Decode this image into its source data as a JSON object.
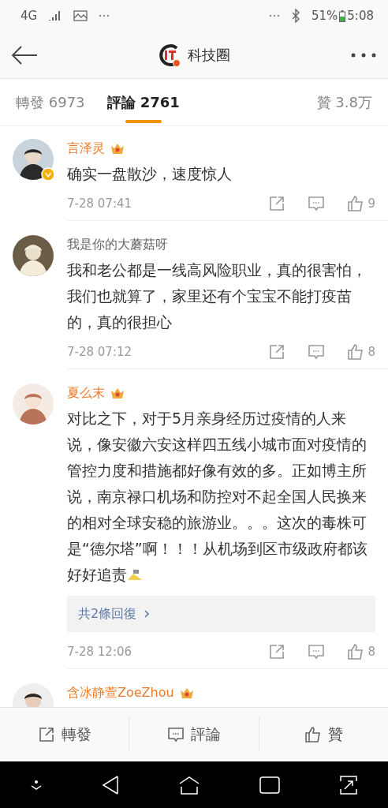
{
  "status_bar": {
    "network": "4G",
    "battery": "51%",
    "time": "5:08"
  },
  "header": {
    "title": "科技圈",
    "verified": true
  },
  "tabs": [
    {
      "label": "轉發 6973",
      "selected": false
    },
    {
      "label": "評論 2761",
      "selected": true
    },
    {
      "label": "贊 3.8万",
      "selected": false
    }
  ],
  "comments": [
    {
      "name": "言泽灵",
      "vip": true,
      "verified": true,
      "text": "确实一盘散沙，速度惊人",
      "emoji": false,
      "time": "7-28 07:41",
      "likes": "9"
    },
    {
      "name": "我是你的大蘑菇呀",
      "vip": false,
      "verified": false,
      "text": "我和老公都是一线高风险职业，真的很害怕，我们也就算了，家里还有个宝宝不能打疫苗的，真的很担心",
      "emoji": false,
      "time": "7-28 07:12",
      "likes": "8"
    },
    {
      "name": "夏么末",
      "vip": true,
      "verified": false,
      "text": "对比之下，对于5月亲身经历过疫情的人来说，像安徽六安这样四五线小城市面对疫情的管控力度和措施都好像有效的多。正如博主所说，南京禄口机场和防控对不起全国人民换来的相对全球安稳的旅游业。。。这次的毒株可是“德尔塔”啊！！！从机场到区市级政府都该好好追责",
      "emoji": true,
      "replies": "共2條回復",
      "time": "7-28 12:06",
      "likes": "8"
    },
    {
      "name": "含冰静萱ZoeZhou",
      "vip": true,
      "verified": false
    }
  ],
  "actions": [
    {
      "kind": "repost",
      "label": "轉發"
    },
    {
      "kind": "comment",
      "label": "評論"
    },
    {
      "kind": "like",
      "label": "贊"
    }
  ]
}
